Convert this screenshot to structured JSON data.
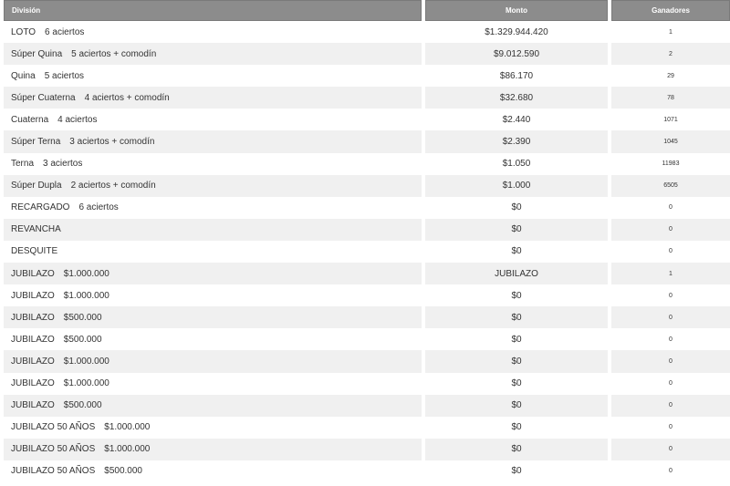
{
  "table": {
    "headers": {
      "division": "División",
      "monto": "Monto",
      "ganadores": "Ganadores"
    },
    "rows": [
      {
        "name": "LOTO",
        "detail": "6 aciertos",
        "monto": "$1.329.944.420",
        "ganadores": "1"
      },
      {
        "name": "Súper Quina",
        "detail": "5 aciertos + comodín",
        "monto": "$9.012.590",
        "ganadores": "2"
      },
      {
        "name": "Quina",
        "detail": "5 aciertos",
        "monto": "$86.170",
        "ganadores": "29"
      },
      {
        "name": "Súper Cuaterna",
        "detail": "4 aciertos + comodín",
        "monto": "$32.680",
        "ganadores": "78"
      },
      {
        "name": "Cuaterna",
        "detail": "4 aciertos",
        "monto": "$2.440",
        "ganadores": "1071"
      },
      {
        "name": "Súper Terna",
        "detail": "3 aciertos + comodín",
        "monto": "$2.390",
        "ganadores": "1045"
      },
      {
        "name": "Terna",
        "detail": "3 aciertos",
        "monto": "$1.050",
        "ganadores": "11983"
      },
      {
        "name": "Súper Dupla",
        "detail": "2 aciertos + comodín",
        "monto": "$1.000",
        "ganadores": "6505"
      },
      {
        "name": "RECARGADO",
        "detail": "6 aciertos",
        "monto": "$0",
        "ganadores": "0"
      },
      {
        "name": "REVANCHA",
        "detail": "",
        "monto": "$0",
        "ganadores": "0"
      },
      {
        "name": "DESQUITE",
        "detail": "",
        "monto": "$0",
        "ganadores": "0"
      },
      {
        "name": "JUBILAZO",
        "detail": "$1.000.000",
        "monto": "JUBILAZO",
        "ganadores": "1"
      },
      {
        "name": "JUBILAZO",
        "detail": "$1.000.000",
        "monto": "$0",
        "ganadores": "0"
      },
      {
        "name": "JUBILAZO",
        "detail": "$500.000",
        "monto": "$0",
        "ganadores": "0"
      },
      {
        "name": "JUBILAZO",
        "detail": "$500.000",
        "monto": "$0",
        "ganadores": "0"
      },
      {
        "name": "JUBILAZO",
        "detail": "$1.000.000",
        "monto": "$0",
        "ganadores": "0"
      },
      {
        "name": "JUBILAZO",
        "detail": "$1.000.000",
        "monto": "$0",
        "ganadores": "0"
      },
      {
        "name": "JUBILAZO",
        "detail": "$500.000",
        "monto": "$0",
        "ganadores": "0"
      },
      {
        "name": "JUBILAZO 50 AÑOS",
        "detail": "$1.000.000",
        "monto": "$0",
        "ganadores": "0"
      },
      {
        "name": "JUBILAZO 50 AÑOS",
        "detail": "$1.000.000",
        "monto": "$0",
        "ganadores": "0"
      },
      {
        "name": "JUBILAZO 50 AÑOS",
        "detail": "$500.000",
        "monto": "$0",
        "ganadores": "0"
      }
    ]
  }
}
